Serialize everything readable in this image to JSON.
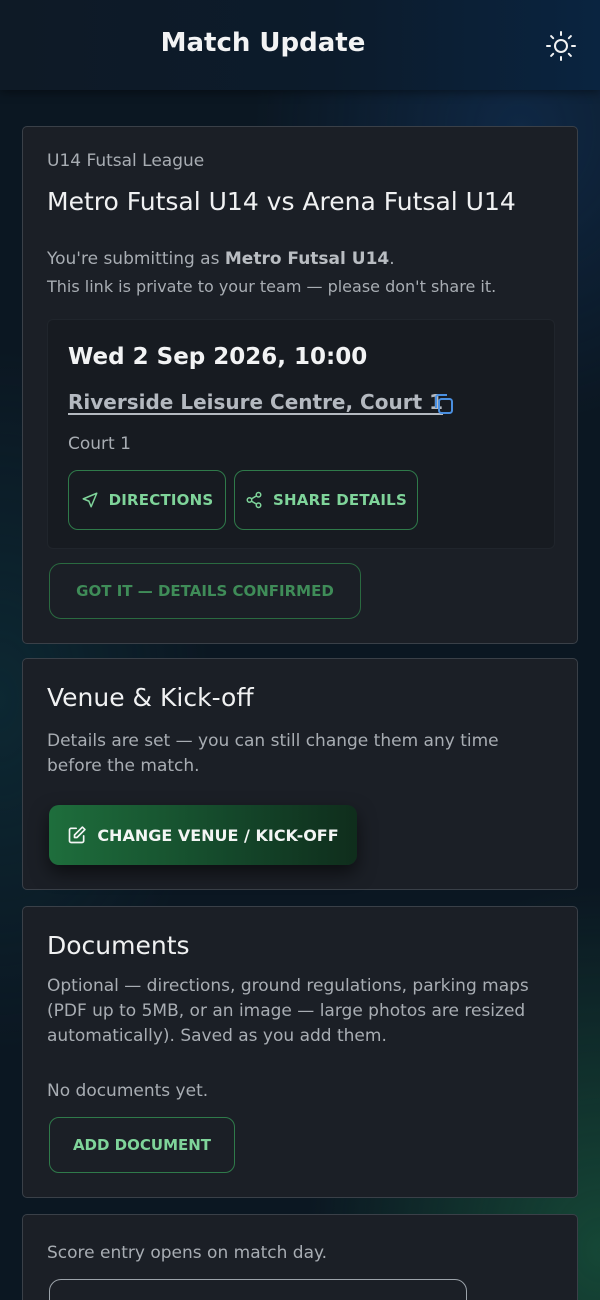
{
  "header": {
    "title": "Match Update",
    "theme_icon": "sun-icon"
  },
  "match": {
    "league": "U14 Futsal League",
    "title": "Metro Futsal U14 vs Arena Futsal U14",
    "submitting_prefix": "You're submitting as ",
    "submitting_team": "Metro Futsal U14",
    "submitting_suffix": ".",
    "private_note": "This link is private to your team — please don't share it.",
    "datetime": "Wed 2 Sep 2026, 10:00",
    "venue": "Riverside Leisure Centre, Court 1",
    "court": "Court 1",
    "directions_label": "DIRECTIONS",
    "share_label": "SHARE DETAILS",
    "confirm_label": "GOT IT — DETAILS CONFIRMED"
  },
  "venue_section": {
    "title": "Venue & Kick-off",
    "text": "Details are set — you can still change them any time before the match.",
    "button_label": "CHANGE VENUE / KICK-OFF"
  },
  "documents": {
    "title": "Documents",
    "text": "Optional — directions, ground regulations, parking maps (PDF up to 5MB, or an image — large photos are resized automatically). Saved as you add them.",
    "empty_text": "No documents yet.",
    "add_label": "ADD DOCUMENT"
  },
  "score": {
    "text": "Score entry opens on match day."
  },
  "colors": {
    "accent_green": "#7fd49a",
    "button_green": "#1e6e3c",
    "card_bg": "#1b1f26",
    "page_bg": "#0b1722",
    "copy_icon": "#4a8fe0"
  }
}
